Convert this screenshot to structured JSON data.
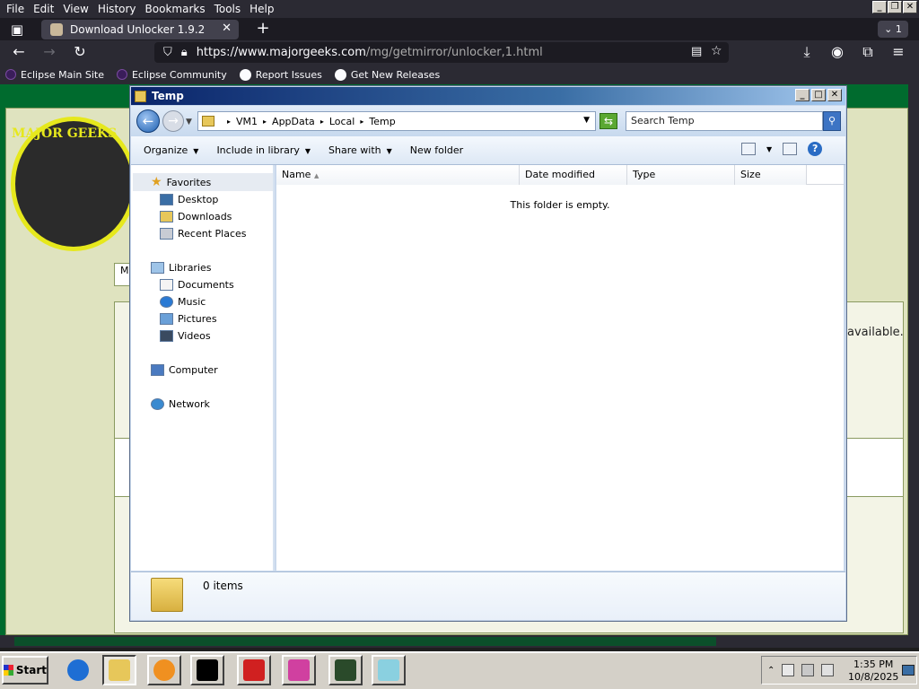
{
  "firefox": {
    "menu": [
      "File",
      "Edit",
      "View",
      "History",
      "Bookmarks",
      "Tools",
      "Help"
    ],
    "tab_title": "Download Unlocker 1.9.2",
    "tab_count": "1",
    "url_host": "https://www.majorgeeks.com",
    "url_path": "/mg/getmirror/unlocker,1.html",
    "bookmarks": [
      "Eclipse Main Site",
      "Eclipse Community",
      "Report Issues",
      "Get New Releases"
    ]
  },
  "webpage": {
    "logo_text": "MAJOR GEEKS",
    "visible_text_fragment": "available.",
    "nav_fragment": "M"
  },
  "explorer": {
    "title": "Temp",
    "breadcrumb": [
      "VM1",
      "AppData",
      "Local",
      "Temp"
    ],
    "search_placeholder": "Search Temp",
    "commands": [
      "Organize",
      "Include in library",
      "Share with",
      "New folder"
    ],
    "nav": {
      "favorites_label": "Favorites",
      "favorites": [
        "Desktop",
        "Downloads",
        "Recent Places"
      ],
      "libraries_label": "Libraries",
      "libraries": [
        "Documents",
        "Music",
        "Pictures",
        "Videos"
      ],
      "computer": "Computer",
      "network": "Network"
    },
    "columns": [
      "Name",
      "Date modified",
      "Type",
      "Size"
    ],
    "empty_message": "This folder is empty.",
    "item_count": "0 items"
  },
  "taskbar": {
    "start": "Start",
    "time": "1:35 PM",
    "date": "10/8/2025"
  },
  "colors": {
    "firefox_dark": "#2b2a33",
    "explorer_title": "#0a246a",
    "page_green": "#006b2e"
  }
}
